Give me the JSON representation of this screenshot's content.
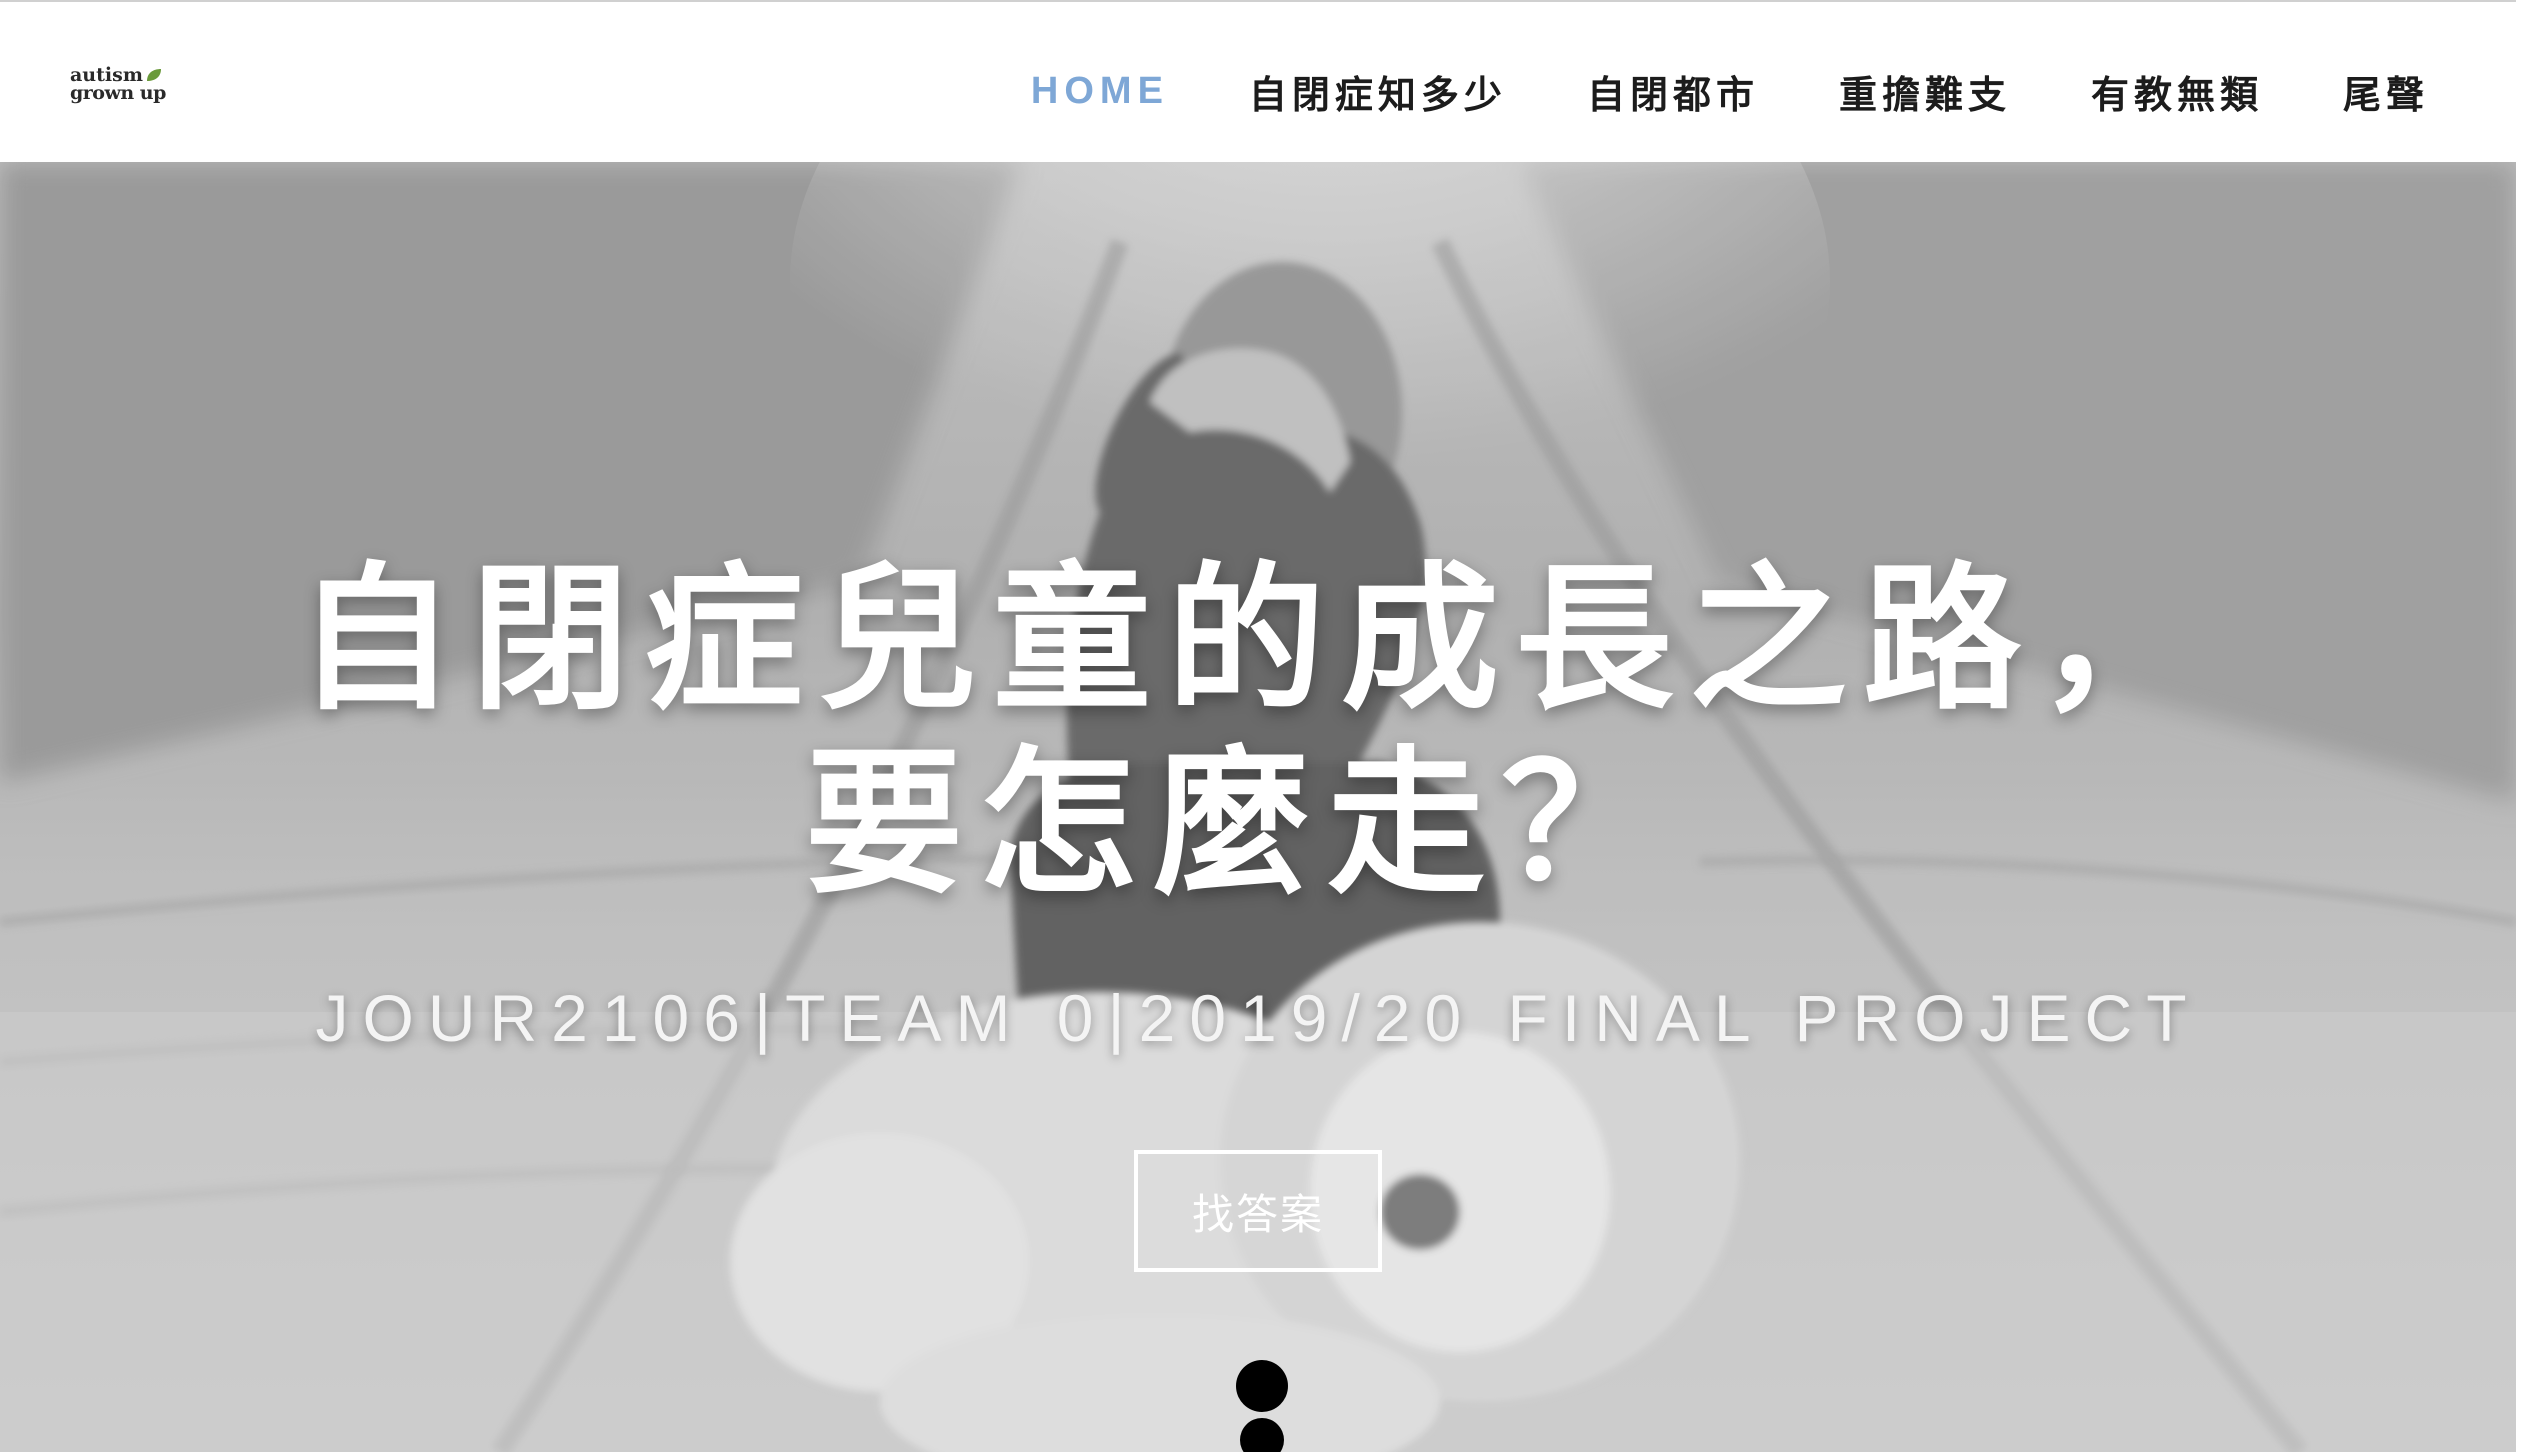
{
  "header": {
    "logo": {
      "line1": "autism",
      "line2": "grown up",
      "leaf_color": "#6a9a3a"
    },
    "nav": [
      {
        "label": "HOME",
        "active": true
      },
      {
        "label": "自閉症知多少",
        "active": false
      },
      {
        "label": "自閉都市",
        "active": false
      },
      {
        "label": "重擔難支",
        "active": false
      },
      {
        "label": "有教無類",
        "active": false
      },
      {
        "label": "尾聲",
        "active": false
      }
    ],
    "active_color": "#7ea7d6"
  },
  "hero": {
    "title_line1": "自閉症兒童的成長之路，",
    "title_line2": "要怎麼走？",
    "subtitle": "JOUR2106|TEAM 0|2019/20 FINAL PROJECT",
    "cta_label": "找答案",
    "background": "grayscale photo: girl carrying a stuffed lion on a gravel path",
    "scroll_indicator": "scroll-down-icon"
  }
}
